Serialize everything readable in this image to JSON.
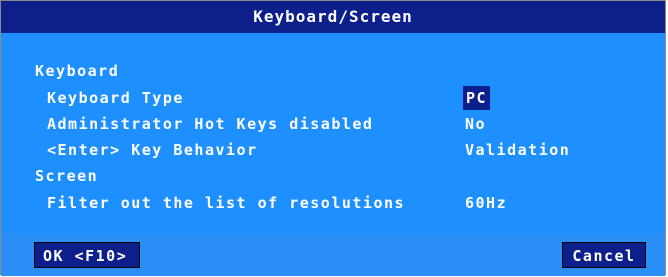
{
  "window": {
    "title": "Keyboard/Screen"
  },
  "sections": {
    "keyboard_heading": "Keyboard",
    "screen_heading": "Screen"
  },
  "settings": {
    "keyboard_type": {
      "label": "Keyboard Type",
      "value": "PC"
    },
    "admin_hot_keys": {
      "label": "Administrator Hot Keys disabled",
      "value": "No"
    },
    "enter_key": {
      "label": "<Enter> Key Behavior",
      "value": "Validation"
    },
    "filter_resolutions": {
      "label": "Filter out the list of resolutions",
      "value": "60Hz"
    }
  },
  "buttons": {
    "ok_label": "OK <F10>",
    "cancel_label": "Cancel"
  },
  "colors": {
    "title_bg": "#0d1f8a",
    "content_bg": "#1e8fff",
    "selected_bg": "#0d1f8a",
    "text": "#ffffff"
  }
}
